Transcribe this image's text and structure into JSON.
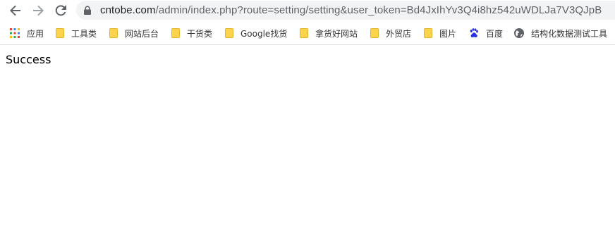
{
  "nav": {
    "back_icon": "arrow-left-icon",
    "forward_icon": "arrow-right-icon",
    "reload_icon": "reload-icon"
  },
  "address": {
    "lock_icon": "lock-icon",
    "host": "cntobe.com",
    "path": "/admin/index.php?route=setting/setting&user_token=Bd4JxIhYv3Q4i8hz542uWDLJa7V3QJpB"
  },
  "bookmarks": [
    {
      "label": "应用",
      "icon": "apps-grid-icon"
    },
    {
      "label": "工具类",
      "icon": "folder-icon"
    },
    {
      "label": "网站后台",
      "icon": "folder-icon"
    },
    {
      "label": "干货类",
      "icon": "folder-icon"
    },
    {
      "label": "Google找货",
      "icon": "folder-icon"
    },
    {
      "label": "拿货好网站",
      "icon": "folder-icon"
    },
    {
      "label": "外贸店",
      "icon": "folder-icon"
    },
    {
      "label": "图片",
      "icon": "folder-icon"
    },
    {
      "label": "百度",
      "icon": "baidu-paw-icon"
    },
    {
      "label": "结构化数据测试工具",
      "icon": "globe-icon"
    }
  ],
  "page": {
    "message": "Success"
  }
}
